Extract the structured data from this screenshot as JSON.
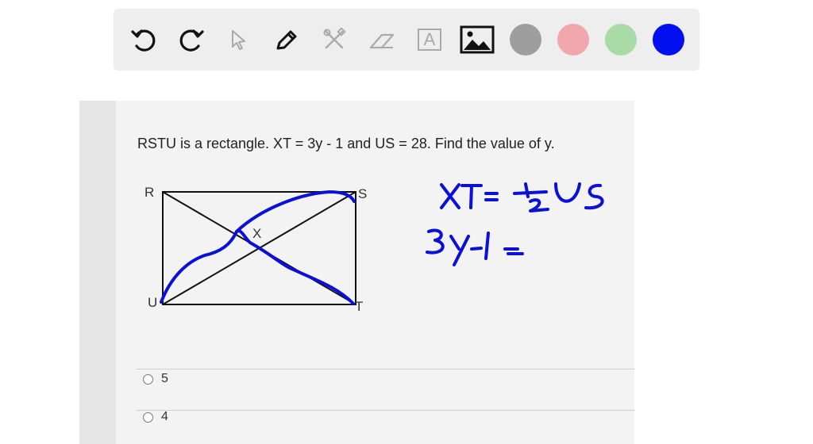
{
  "toolbar": {
    "tools": [
      {
        "name": "undo-icon"
      },
      {
        "name": "redo-icon"
      },
      {
        "name": "pointer-icon"
      },
      {
        "name": "pen-icon"
      },
      {
        "name": "tools-icon"
      },
      {
        "name": "eraser-icon"
      },
      {
        "name": "text-icon",
        "glyph": "A"
      },
      {
        "name": "image-icon"
      }
    ],
    "colors": [
      "#9e9e9e",
      "#f2a7ae",
      "#a9dba7",
      "#0010ee"
    ]
  },
  "question": {
    "text": "RSTU is a rectangle.  XT = 3y - 1 and US = 28.  Find the value of y."
  },
  "figure": {
    "vertices": {
      "r": "R",
      "s": "S",
      "t": "T",
      "u": "U",
      "x": "X"
    }
  },
  "options": [
    {
      "label": "5"
    },
    {
      "label": "4"
    }
  ],
  "annotations": {
    "line1": "XT = ½US",
    "line2": "3y-1 ="
  },
  "ink_color": "#0b10d8"
}
